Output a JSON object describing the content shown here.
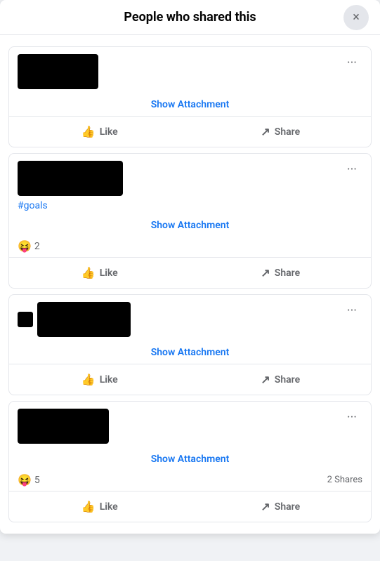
{
  "modal": {
    "title": "People who shared this",
    "close_label": "×"
  },
  "posts": [
    {
      "id": "post-1",
      "avatar_width": 115,
      "avatar_height": 50,
      "tag": "",
      "show_attachment_label": "Show Attachment",
      "reactions": [],
      "reaction_count": null,
      "shares_count": null,
      "like_label": "Like",
      "share_label": "Share"
    },
    {
      "id": "post-2",
      "avatar_width": 150,
      "avatar_height": 50,
      "tag": "#goals",
      "show_attachment_label": "Show Attachment",
      "reactions": [
        "😝"
      ],
      "reaction_count": "2",
      "shares_count": null,
      "like_label": "Like",
      "share_label": "Share"
    },
    {
      "id": "post-3",
      "avatar_width": 155,
      "avatar_height": 50,
      "tag": "",
      "show_attachment_label": "Show Attachment",
      "reactions": [],
      "reaction_count": null,
      "shares_count": null,
      "like_label": "Like",
      "share_label": "Share"
    },
    {
      "id": "post-4",
      "avatar_width": 130,
      "avatar_height": 50,
      "tag": "",
      "show_attachment_label": "Show Attachment",
      "reactions": [
        "😝"
      ],
      "reaction_count": "5",
      "shares_count": "2 Shares",
      "like_label": "Like",
      "share_label": "Share"
    }
  ],
  "icons": {
    "more": "•••",
    "like": "👍",
    "share": "↗",
    "close": "✕"
  }
}
